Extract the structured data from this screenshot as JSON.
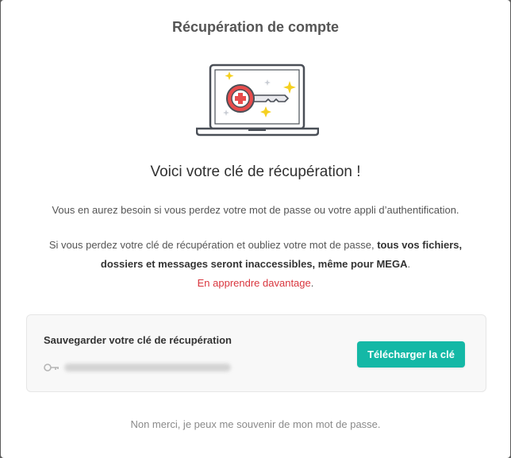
{
  "dialog": {
    "title": "Récupération de compte",
    "illustration_icon": "laptop-recovery-key-icon",
    "heading": "Voici votre clé de récupération !",
    "paragraph1": "Vous en aurez besoin si vous perdez votre mot de passe ou votre appli d’authentification.",
    "paragraph2_prefix": "Si vous perdez votre clé de récupération et oubliez votre mot de passe, ",
    "paragraph2_bold": "tous vos fichiers, dossiers et messages seront inaccessibles, même pour MEGA",
    "paragraph2_suffix": ".",
    "learn_more": "En apprendre davantage",
    "learn_more_suffix": ".",
    "save_section": {
      "title": "Sauvegarder votre clé de récupération",
      "key_icon": "key-icon",
      "download_button": "Télécharger la clé"
    },
    "dismiss_link": "Non merci, je peux me souvenir de mon mot de passe."
  },
  "colors": {
    "accent": "#14b8a6",
    "link_red": "#d9363e",
    "mega_red": "#e84c4c",
    "sparkle_yellow": "#f5d020"
  }
}
